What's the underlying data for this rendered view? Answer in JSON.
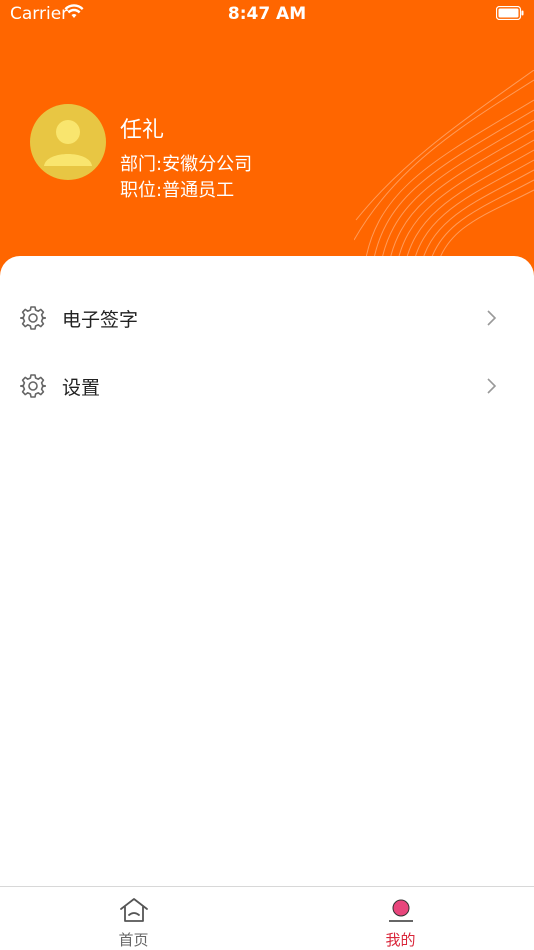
{
  "status_bar": {
    "carrier": "Carrier",
    "time": "8:47 AM"
  },
  "profile": {
    "name": "任礼",
    "department": "部门:安徽分公司",
    "position": "职位:普通员工"
  },
  "menu": {
    "items": [
      {
        "label": "电子签字",
        "icon": "gear-icon"
      },
      {
        "label": "设置",
        "icon": "gear-icon"
      }
    ]
  },
  "tabbar": {
    "home_label": "首页",
    "mine_label": "我的"
  },
  "colors": {
    "header_bg": "#ff6600",
    "avatar_bg": "#e8c643",
    "active_tab": "#d9263a",
    "active_tab_icon": "#e8467c"
  }
}
